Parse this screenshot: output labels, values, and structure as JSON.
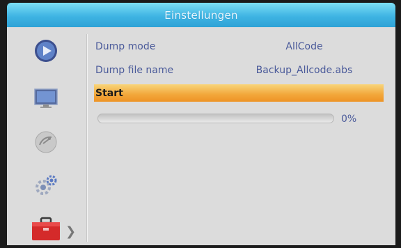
{
  "title": "Einstellungen",
  "sidebar": {
    "items": [
      {
        "icon": "play-icon"
      },
      {
        "icon": "monitor-icon"
      },
      {
        "icon": "satellite-dish-icon"
      },
      {
        "icon": "settings-gear-icon"
      },
      {
        "icon": "toolbox-icon",
        "selected": true
      }
    ]
  },
  "settings": {
    "dump_mode_label": "Dump mode",
    "dump_mode_value": "AllCode",
    "dump_file_label": "Dump file name",
    "dump_file_value": "Backup_Allcode.abs",
    "start_label": "Start"
  },
  "progress": {
    "value_percent": 0,
    "label": "0%"
  },
  "colors": {
    "accent": "#3fb4e3",
    "highlight": "#f2a63a",
    "text": "#4a5a9a"
  }
}
